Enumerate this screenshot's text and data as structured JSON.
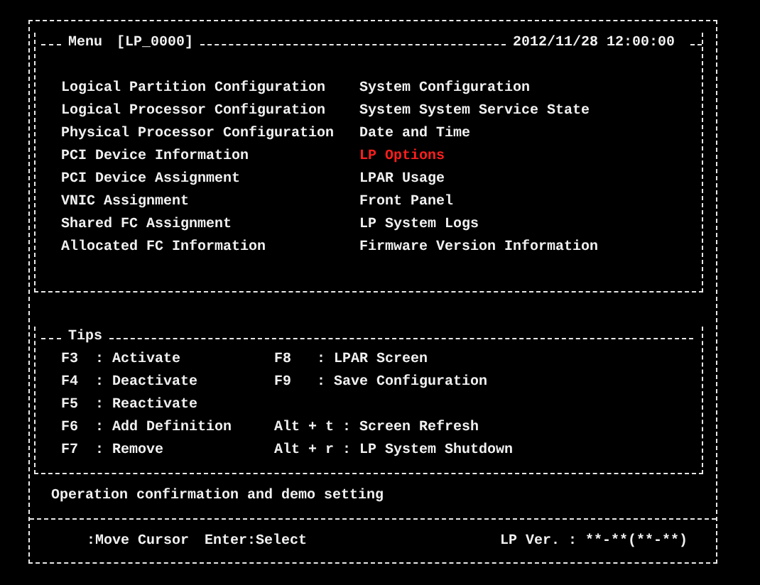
{
  "menu": {
    "title": "Menu",
    "lp_id": "[LP_0000]",
    "datetime": "2012/11/28 12:00:00",
    "columns": [
      {
        "items": [
          {
            "label": "Logical Partition Configuration",
            "selected": false
          },
          {
            "label": "Logical Processor Configuration",
            "selected": false
          },
          {
            "label": "Physical Processor Configuration",
            "selected": false
          },
          {
            "label": "PCI Device Information",
            "selected": false
          },
          {
            "label": "PCI Device Assignment",
            "selected": false
          },
          {
            "label": "VNIC Assignment",
            "selected": false
          },
          {
            "label": "Shared FC Assignment",
            "selected": false
          },
          {
            "label": "Allocated FC Information",
            "selected": false
          }
        ]
      },
      {
        "items": [
          {
            "label": "System Configuration",
            "selected": false
          },
          {
            "label": "System System Service State",
            "selected": false
          },
          {
            "label": "Date and Time",
            "selected": false
          },
          {
            "label": "LP Options",
            "selected": true
          },
          {
            "label": "LPAR Usage",
            "selected": false
          },
          {
            "label": "Front Panel",
            "selected": false
          },
          {
            "label": "LP System Logs",
            "selected": false
          },
          {
            "label": "Firmware Version Information",
            "selected": false
          }
        ]
      }
    ]
  },
  "tips": {
    "title": "Tips",
    "rows": [
      {
        "left": "F3  : Activate",
        "right": "F8   : LPAR Screen"
      },
      {
        "left": "F4  : Deactivate",
        "right": "F9   : Save Configuration"
      },
      {
        "left": "F5  : Reactivate"
      },
      {
        "left": "F6  : Add Definition",
        "right": "Alt + t : Screen Refresh"
      },
      {
        "left": "F7  : Remove",
        "right": "Alt + r : LP System Shutdown"
      }
    ]
  },
  "message": "Operation confirmation and demo setting",
  "footer": {
    "hints": [
      ":Move Cursor",
      "Enter:Select"
    ],
    "version_label": "LP Ver. :",
    "version": "**-**(**-**)"
  }
}
